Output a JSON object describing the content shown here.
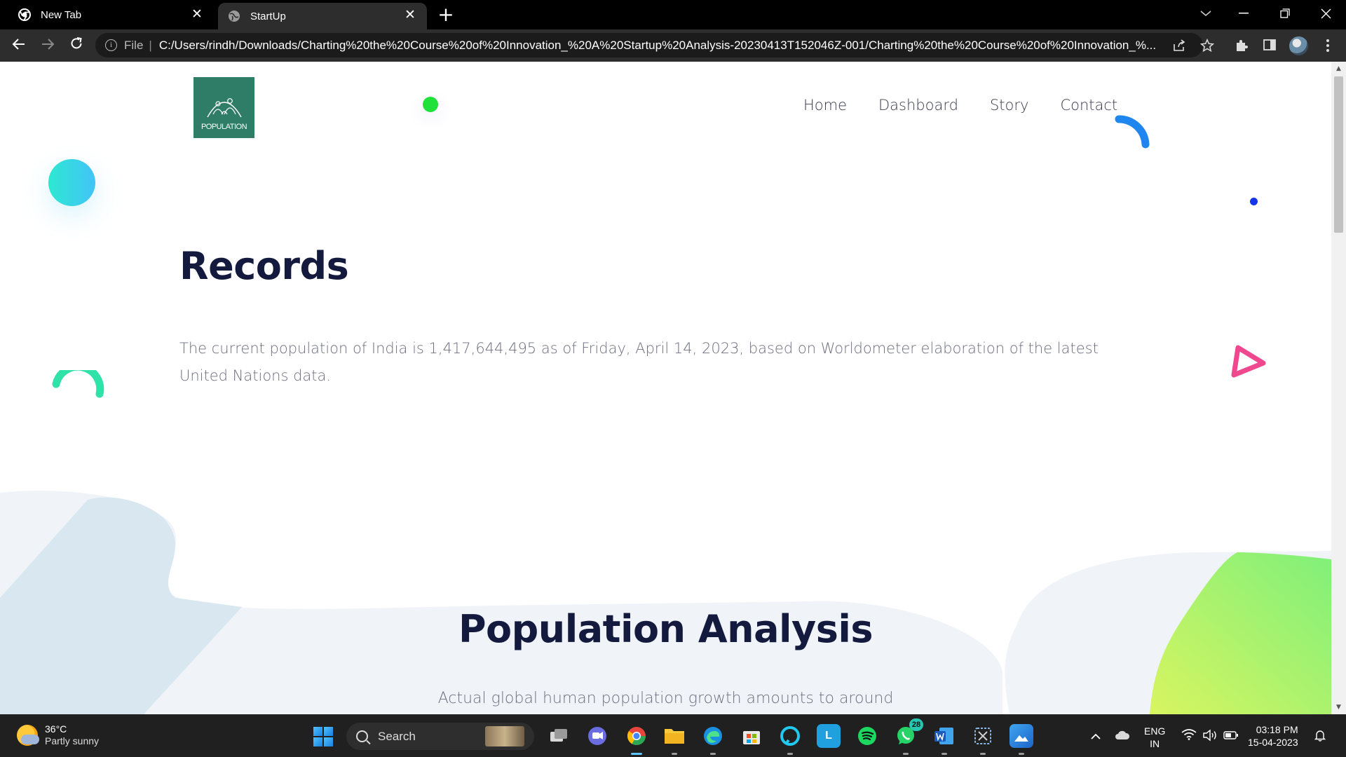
{
  "browser": {
    "tabs": [
      {
        "title": "New Tab",
        "active": false,
        "icon": "chrome-icon"
      },
      {
        "title": "StartUp",
        "active": true,
        "icon": "globe-icon"
      }
    ],
    "new_tab_label": "+",
    "address": {
      "scheme_label": "File",
      "url": "C:/Users/rindh/Downloads/Charting%20the%20Course%20of%20Innovation_%20A%20Startup%20Analysis-20230413T152046Z-001/Charting%20the%20Course%20of%20Innovation_%..."
    }
  },
  "page": {
    "logo_text": "POPULATION",
    "nav": [
      "Home",
      "Dashboard",
      "Story",
      "Contact"
    ],
    "records": {
      "title": "Records",
      "text": "The current population of India is 1,417,644,495 as of Friday, April 14, 2023, based on Worldometer elaboration of the latest United Nations data."
    },
    "analysis": {
      "title": "Population Analysis",
      "text": "Actual global human population growth amounts to around"
    },
    "colors": {
      "heading": "#131a3d",
      "body_text": "#6e6e80",
      "logo_bg": "#2f7d67",
      "accent_green": "#20e03a",
      "accent_blue": "#1634e8",
      "accent_pink": "#f0488f"
    }
  },
  "taskbar": {
    "weather": {
      "temp": "36°C",
      "condition": "Partly sunny"
    },
    "search_placeholder": "Search",
    "whatsapp_badge": "28",
    "language": [
      "ENG",
      "IN"
    ],
    "time": "03:18 PM",
    "date": "15-04-2023"
  }
}
